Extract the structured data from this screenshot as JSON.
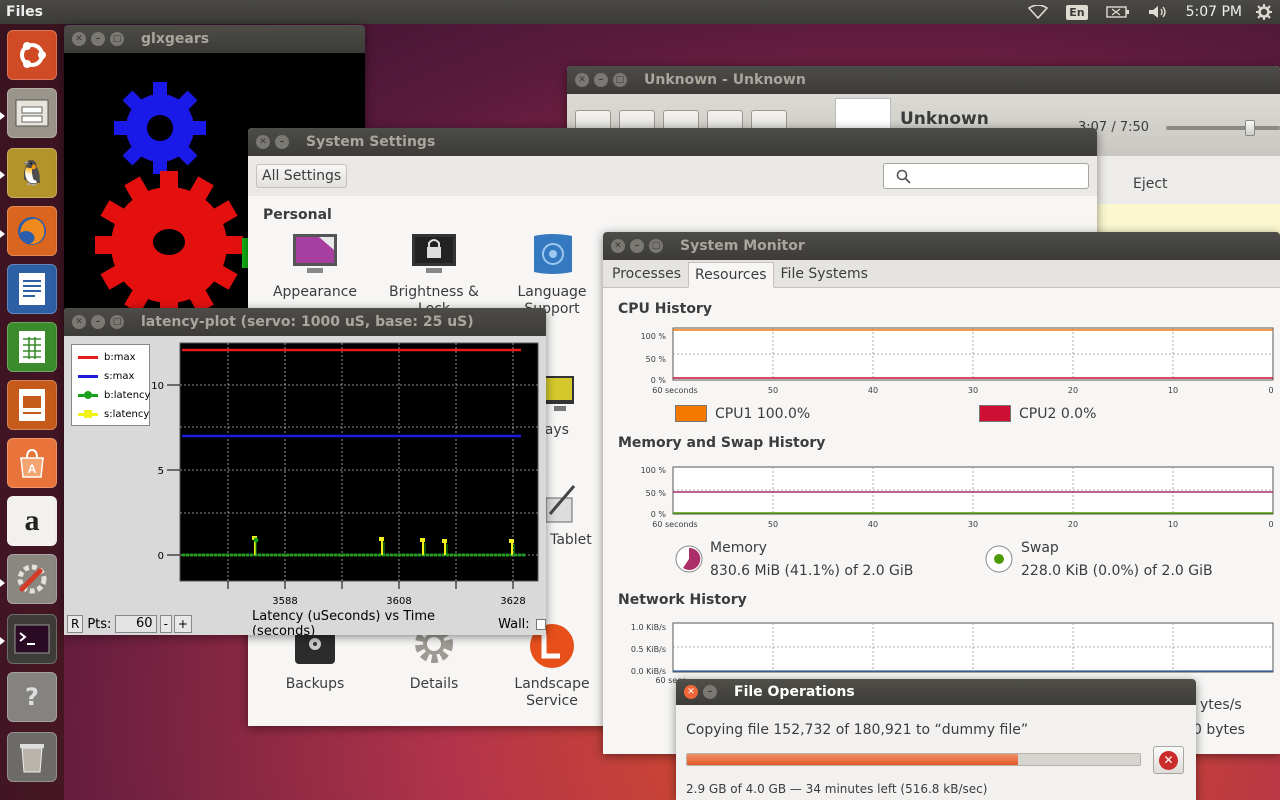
{
  "top_panel": {
    "app_name": "Files",
    "lang": "En",
    "clock": "5:07 PM"
  },
  "launcher": {
    "items": [
      "ubuntu-dash",
      "files",
      "pingus",
      "firefox",
      "writer",
      "calc",
      "impress",
      "software-center",
      "amazon",
      "system-settings",
      "terminal",
      "unknown-app",
      "trash"
    ]
  },
  "glxgears": {
    "title": "glxgears"
  },
  "media_player": {
    "title": "Unknown - Unknown",
    "song": "Unknown",
    "time": "3:07 / 7:50",
    "progress": 0.4,
    "eject_label": "Eject"
  },
  "system_settings": {
    "title": "System Settings",
    "all_settings": "All Settings",
    "section_personal": "Personal",
    "items": {
      "appearance": "Appearance",
      "brightness": "Brightness &\nLock",
      "language": "Language\nSupport",
      "displays": "plays",
      "wacom": "m Tablet",
      "backups": "Backups",
      "details": "Details",
      "landscape": "Landscape\nService"
    }
  },
  "latency_plot": {
    "title": "latency-plot (servo: 1000 uS, base: 25 uS)",
    "legend": [
      "b:max",
      "s:max",
      "b:latency",
      "s:latency"
    ],
    "y_ticks": [
      "10",
      "5",
      "0"
    ],
    "x_ticks": [
      "3588",
      "3608",
      "3628"
    ],
    "r_button": "R",
    "pts_label": "Pts:",
    "pts_value": "60",
    "minus": "-",
    "plus": "+",
    "axis_caption": "Latency (uSeconds) vs Time (seconds)",
    "wall_label": "Wall:",
    "colors": {
      "b_max": "#e51c1c",
      "s_max": "#1c1cd9",
      "b_latency": "#1aa01a",
      "s_latency": "#f2f21a"
    }
  },
  "system_monitor": {
    "title": "System Monitor",
    "tabs": [
      "Processes",
      "Resources",
      "File Systems"
    ],
    "cpu_history": "CPU History",
    "mem_history": "Memory and Swap History",
    "net_history": "Network History",
    "pct_ticks": [
      "100 %",
      "50 %",
      "0 %"
    ],
    "x_ticks": [
      "60 seconds",
      "50",
      "40",
      "30",
      "20",
      "10",
      "0"
    ],
    "net_ticks": [
      "1.0 KiB/s",
      "0.5 KiB/s",
      "0.0 KiB/s"
    ],
    "net_x_first": "60 seco",
    "cpu1": "CPU1  100.0%",
    "cpu2": "CPU2  0.0%",
    "memory_label": "Memory",
    "memory_value": "830.6 MiB (41.1%) of 2.0 GiB",
    "swap_label": "Swap",
    "swap_value": "228.0 KiB (0.0%) of 2.0 GiB",
    "net_right_1": "ytes/s",
    "net_right_2": "0 bytes",
    "colors": {
      "cpu1": "#f57900",
      "cpu2": "#cc0f32",
      "memory": "#ad2f6a",
      "swap": "#4e9a06"
    }
  },
  "file_ops": {
    "title": "File Operations",
    "message": "Copying file 152,732 of 180,921 to “dummy file”",
    "progress": 0.73,
    "detail": "2.9 GB of 4.0 GB — 34 minutes left (516.8 kB/sec)"
  }
}
